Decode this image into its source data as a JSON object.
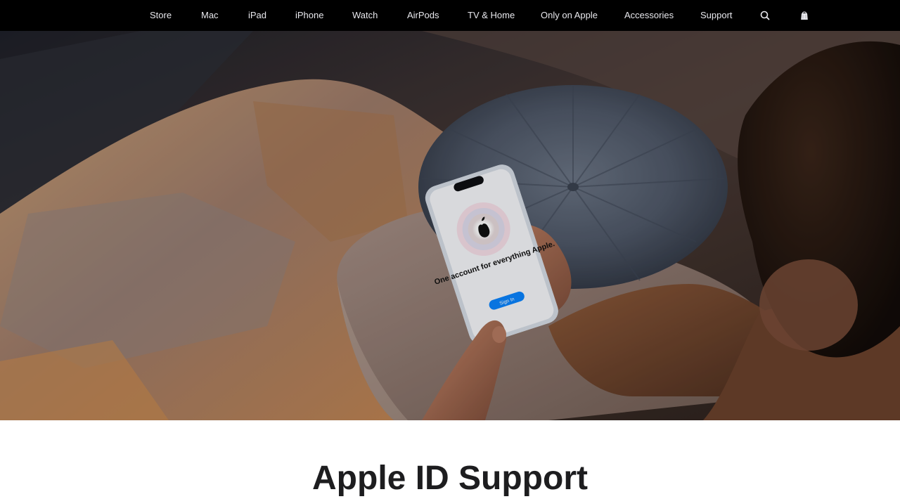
{
  "nav": {
    "items": [
      {
        "label": "Store"
      },
      {
        "label": "Mac"
      },
      {
        "label": "iPad"
      },
      {
        "label": "iPhone"
      },
      {
        "label": "Watch"
      },
      {
        "label": "AirPods"
      },
      {
        "label": "TV & Home"
      },
      {
        "label": "Only on Apple"
      },
      {
        "label": "Accessories"
      },
      {
        "label": "Support"
      }
    ],
    "search_icon": "search-icon",
    "bag_icon": "shopping-bag-icon"
  },
  "hero": {
    "image": "person-holding-iphone-on-couch",
    "phone_screen": {
      "heading": "One account for everything Apple.",
      "button": "Sign In"
    }
  },
  "page": {
    "title": "Apple ID Support"
  }
}
